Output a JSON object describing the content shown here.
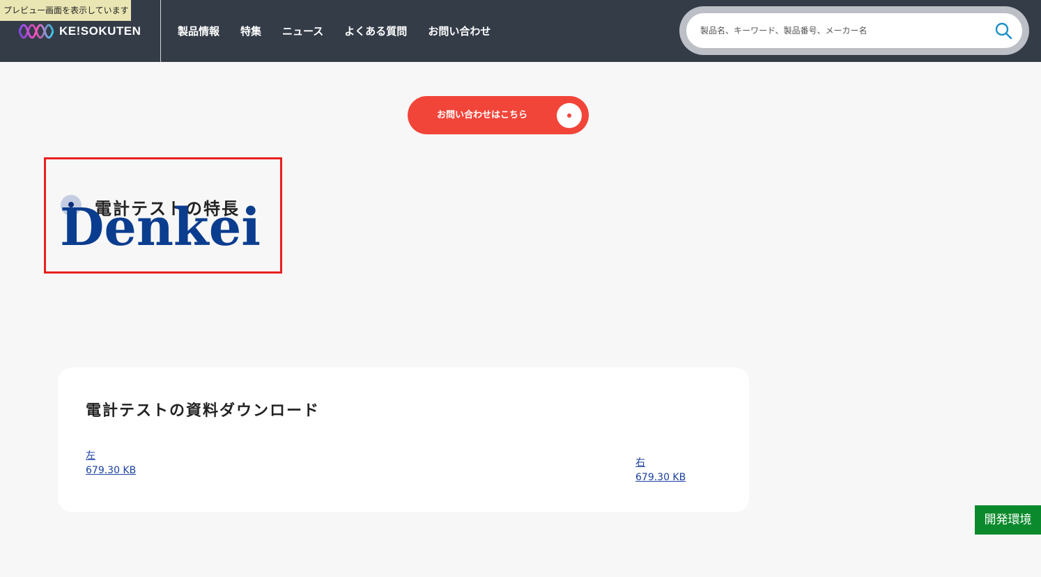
{
  "preview_banner": "プレビュー画面を表示しています",
  "brand": {
    "logo_text": "KE!SOKUTEN"
  },
  "nav": {
    "items": [
      {
        "label": "製品情報"
      },
      {
        "label": "特集"
      },
      {
        "label": "ニュース"
      },
      {
        "label": "よくある質問"
      },
      {
        "label": "お問い合わせ"
      }
    ]
  },
  "search": {
    "placeholder": "製品名、キーワード、製品番号、メーカー名",
    "value": ""
  },
  "contact_button": {
    "label": "お問い合わせはこちら"
  },
  "feature": {
    "title": "電計テストの特長",
    "image_alt": "Denkei"
  },
  "downloads": {
    "title": "電計テストの資料ダウンロード",
    "files": [
      {
        "name": "左",
        "size": "679.30 KB"
      },
      {
        "name": "右",
        "size": "679.30 KB"
      }
    ]
  },
  "env_badge": "開発環境",
  "colors": {
    "header_bg": "#343c48",
    "accent_red": "#f2453a",
    "link_blue": "#1a3fa0",
    "env_green": "#0a8a2c",
    "denkei_blue": "#0b3d8f"
  }
}
